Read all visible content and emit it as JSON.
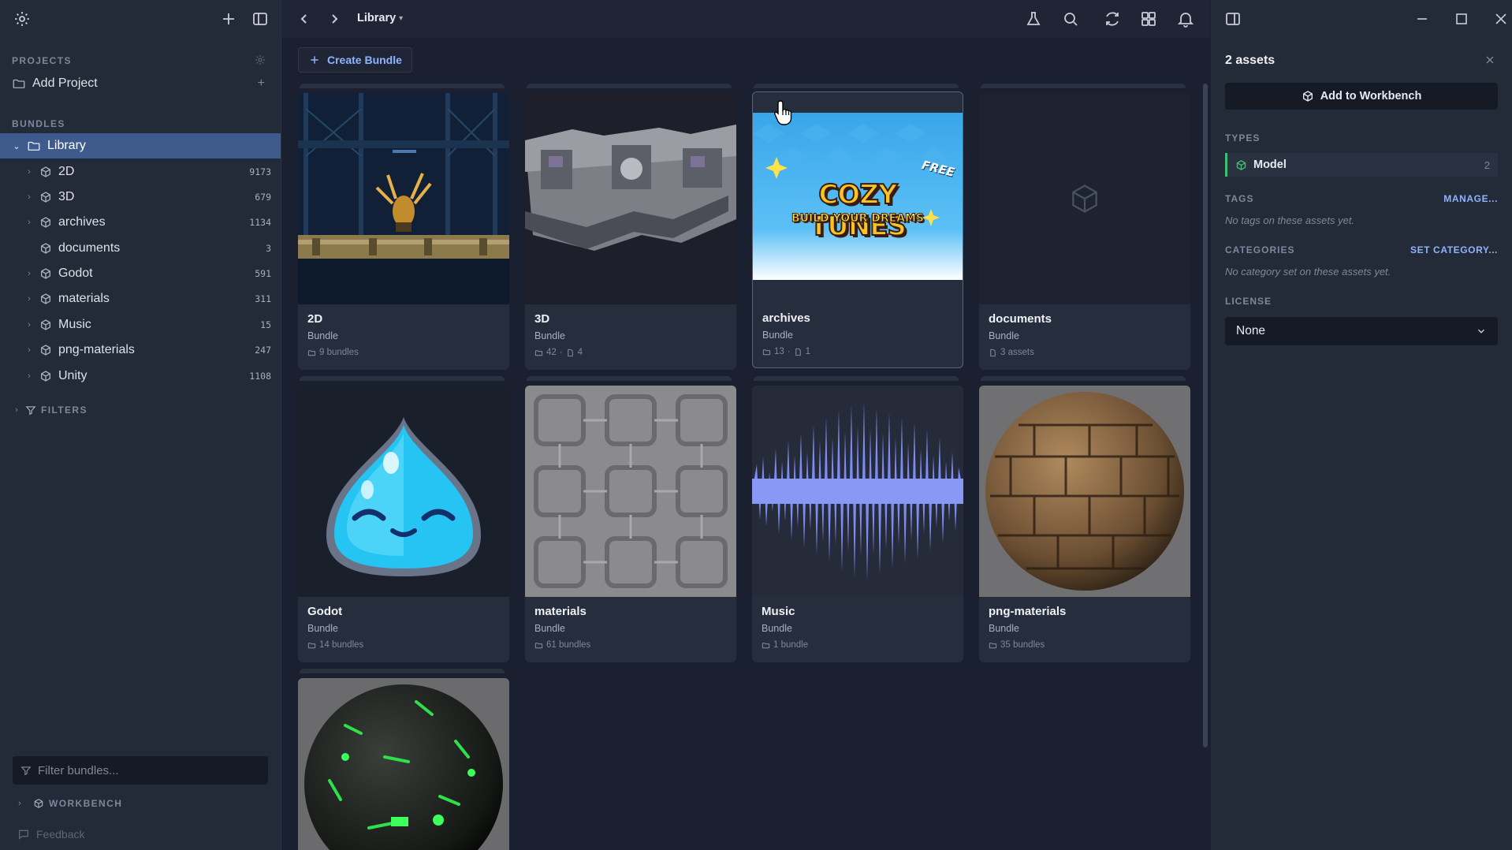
{
  "sidebar": {
    "projects_heading": "PROJECTS",
    "add_project": "Add Project",
    "bundles_heading": "BUNDLES",
    "library": "Library",
    "items": [
      {
        "label": "2D",
        "count": "9173"
      },
      {
        "label": "3D",
        "count": "679"
      },
      {
        "label": "archives",
        "count": "1134"
      },
      {
        "label": "documents",
        "count": "3"
      },
      {
        "label": "Godot",
        "count": "591"
      },
      {
        "label": "materials",
        "count": "311"
      },
      {
        "label": "Music",
        "count": "15"
      },
      {
        "label": "png-materials",
        "count": "247"
      },
      {
        "label": "Unity",
        "count": "1108"
      }
    ],
    "filters_heading": "FILTERS",
    "filter_placeholder": "Filter bundles...",
    "workbench_heading": "WORKBENCH",
    "feedback": "Feedback"
  },
  "topbar": {
    "breadcrumb": "Library"
  },
  "main": {
    "create_bundle": "Create Bundle",
    "cards": [
      {
        "name": "2D",
        "type": "Bundle",
        "meta": "9 bundles"
      },
      {
        "name": "3D",
        "type": "Bundle",
        "meta_a": "42",
        "meta_b": "4"
      },
      {
        "name": "archives",
        "type": "Bundle",
        "meta_a": "13",
        "meta_b": "1"
      },
      {
        "name": "documents",
        "type": "Bundle",
        "meta": "3 assets"
      },
      {
        "name": "Godot",
        "type": "Bundle",
        "meta": "14 bundles"
      },
      {
        "name": "materials",
        "type": "Bundle",
        "meta": "61 bundles"
      },
      {
        "name": "Music",
        "type": "Bundle",
        "meta": "1 bundle"
      },
      {
        "name": "png-materials",
        "type": "Bundle",
        "meta": "35 bundles"
      }
    ],
    "cozy": {
      "free": "FREE",
      "title": "COZY TUNES",
      "subtitle": "BUILD YOUR DREAMS"
    }
  },
  "panel": {
    "title": "2 assets",
    "add_to_workbench": "Add to Workbench",
    "types_heading": "TYPES",
    "type_label": "Model",
    "type_count": "2",
    "tags_heading": "TAGS",
    "manage": "MANAGE...",
    "no_tags": "No tags on these assets yet.",
    "categories_heading": "CATEGORIES",
    "set_category": "SET CATEGORY...",
    "no_category": "No category set on these assets yet.",
    "license_heading": "LICENSE",
    "license_value": "None"
  },
  "colors": {
    "accent": "#8fb4ff",
    "active": "#3f5b8e",
    "type_green": "#3fbf6f"
  }
}
